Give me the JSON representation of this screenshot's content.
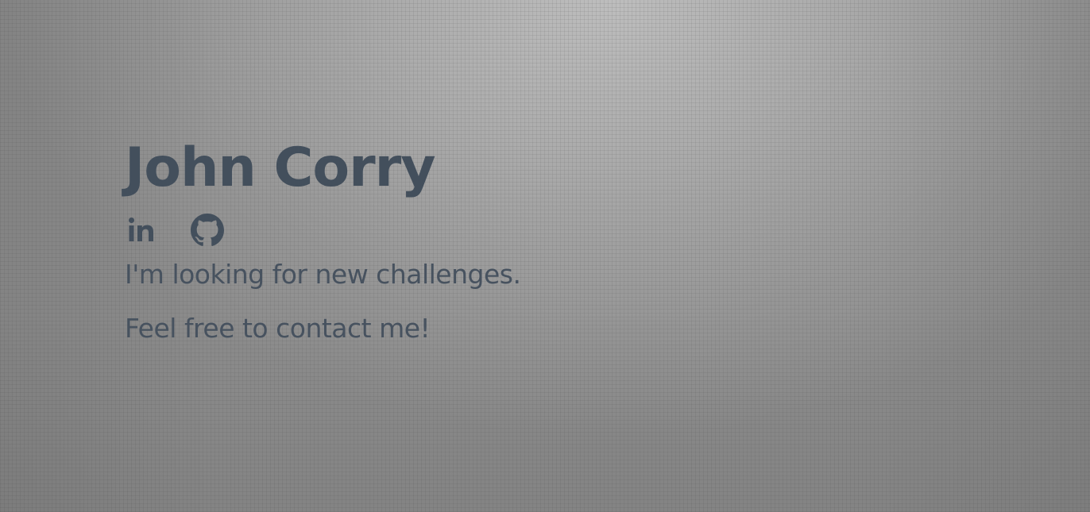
{
  "profile": {
    "name": "John Corry",
    "tagline": "I'm looking for new challenges.",
    "contact_text": "Feel free to contact me!"
  },
  "social": {
    "items": [
      {
        "icon": "linkedin-icon"
      },
      {
        "icon": "github-icon"
      }
    ]
  },
  "colors": {
    "text": "#434f5c",
    "background": "#a3a3a3"
  }
}
